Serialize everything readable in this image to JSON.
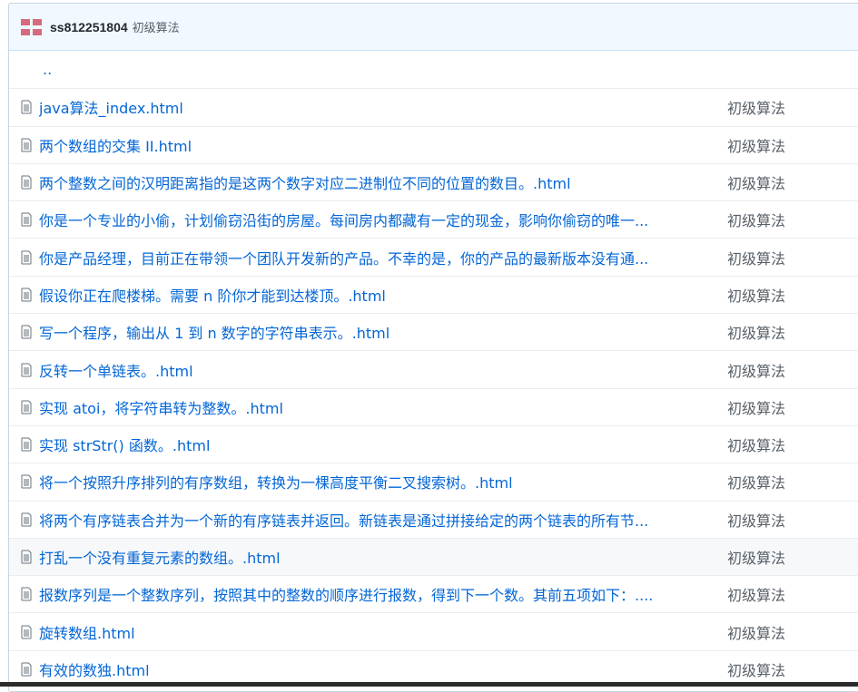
{
  "header": {
    "user": "ss812251804",
    "commit_message": "初级算法"
  },
  "parent_dir": "..",
  "files": [
    {
      "name": "java算法_index.html",
      "message": "初级算法"
    },
    {
      "name": "两个数组的交集 II.html",
      "message": "初级算法"
    },
    {
      "name": "两个整数之间的汉明距离指的是这两个数字对应二进制位不同的位置的数目。.html",
      "message": "初级算法"
    },
    {
      "name": "你是一个专业的小偷，计划偷窃沿街的房屋。每间房内都藏有一定的现金，影响你偷窃的唯一...",
      "message": "初级算法"
    },
    {
      "name": "你是产品经理，目前正在带领一个团队开发新的产品。不幸的是，你的产品的最新版本没有通...",
      "message": "初级算法"
    },
    {
      "name": "假设你正在爬楼梯。需要 n 阶你才能到达楼顶。.html",
      "message": "初级算法"
    },
    {
      "name": "写一个程序，输出从 1 到 n 数字的字符串表示。.html",
      "message": "初级算法"
    },
    {
      "name": "反转一个单链表。.html",
      "message": "初级算法"
    },
    {
      "name": "实现 atoi，将字符串转为整数。.html",
      "message": "初级算法"
    },
    {
      "name": "实现 strStr() 函数。.html",
      "message": "初级算法"
    },
    {
      "name": "将一个按照升序排列的有序数组，转换为一棵高度平衡二叉搜索树。.html",
      "message": "初级算法"
    },
    {
      "name": "将两个有序链表合并为一个新的有序链表并返回。新链表是通过拼接给定的两个链表的所有节...",
      "message": "初级算法"
    },
    {
      "name": "打乱一个没有重复元素的数组。.html",
      "message": "初级算法"
    },
    {
      "name": "报数序列是一个整数序列，按照其中的整数的顺序进行报数，得到下一个数。其前五项如下：....",
      "message": "初级算法"
    },
    {
      "name": "旋转数组.html",
      "message": "初级算法"
    },
    {
      "name": "有效的数独.html",
      "message": "初级算法"
    }
  ],
  "colors": {
    "link": "#0366d6",
    "muted": "#586069",
    "header_bg": "#f1f8ff",
    "logo": "#d66a7e"
  }
}
